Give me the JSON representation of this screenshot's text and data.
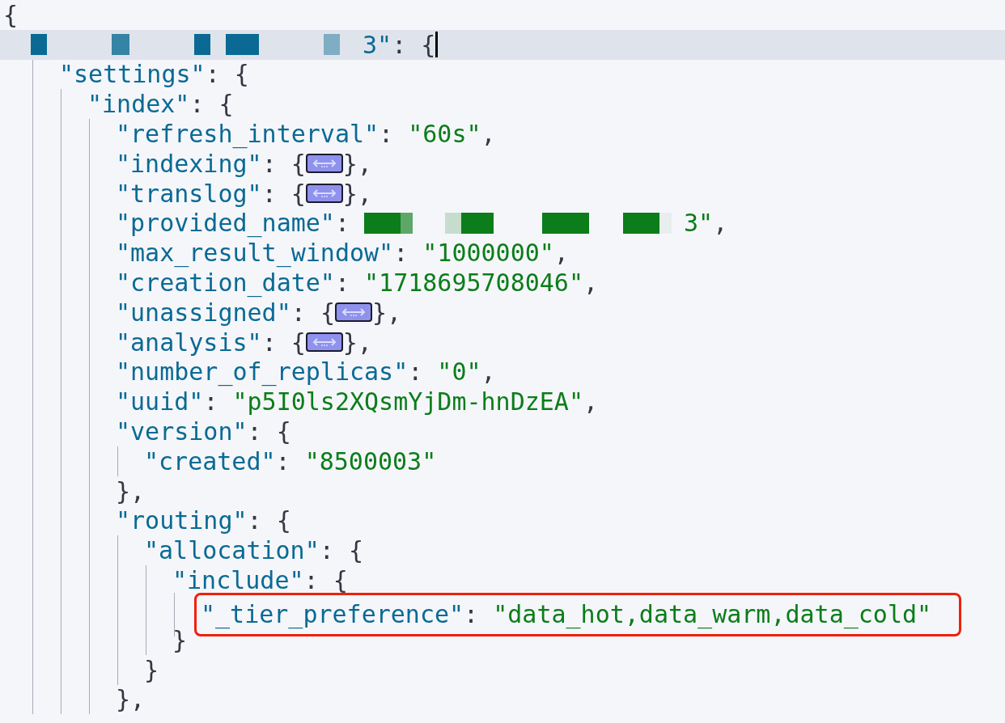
{
  "document": {
    "open": "{",
    "children": [
      {
        "redacted": true,
        "key_tail": "3\"",
        "sep": ": ",
        "open": "{",
        "current": true,
        "children": [
          {
            "key": "\"settings\"",
            "sep": ": ",
            "open": "{",
            "children": [
              {
                "key": "\"index\"",
                "sep": ": ",
                "open": "{",
                "children": [
                  {
                    "key": "\"refresh_interval\"",
                    "sep": ": ",
                    "value": "\"60s\"",
                    "end": ","
                  },
                  {
                    "key": "\"indexing\"",
                    "sep": ": ",
                    "open": "{",
                    "collapsed": true,
                    "close": "},"
                  },
                  {
                    "key": "\"translog\"",
                    "sep": ": ",
                    "open": "{",
                    "collapsed": true,
                    "close": "},"
                  },
                  {
                    "key": "\"provided_name\"",
                    "sep": ": ",
                    "value_redacted": true,
                    "value_tail": "3\"",
                    "end": ","
                  },
                  {
                    "key": "\"max_result_window\"",
                    "sep": ": ",
                    "value": "\"1000000\"",
                    "end": ","
                  },
                  {
                    "key": "\"creation_date\"",
                    "sep": ": ",
                    "value": "\"1718695708046\"",
                    "end": ","
                  },
                  {
                    "key": "\"unassigned\"",
                    "sep": ": ",
                    "open": "{",
                    "collapsed": true,
                    "close": "},"
                  },
                  {
                    "key": "\"analysis\"",
                    "sep": ": ",
                    "open": "{",
                    "collapsed": true,
                    "close": "},"
                  },
                  {
                    "key": "\"number_of_replicas\"",
                    "sep": ": ",
                    "value": "\"0\"",
                    "end": ","
                  },
                  {
                    "key": "\"uuid\"",
                    "sep": ": ",
                    "value": "\"p5I0ls2XQsmYjDm-hnDzEA\"",
                    "end": ","
                  },
                  {
                    "key": "\"version\"",
                    "sep": ": ",
                    "open": "{",
                    "close": "},",
                    "children": [
                      {
                        "key": "\"created\"",
                        "sep": ": ",
                        "value": "\"8500003\""
                      }
                    ]
                  },
                  {
                    "key": "\"routing\"",
                    "sep": ": ",
                    "open": "{",
                    "close": "},",
                    "children": [
                      {
                        "key": "\"allocation\"",
                        "sep": ": ",
                        "open": "{",
                        "close": "}",
                        "children": [
                          {
                            "key": "\"include\"",
                            "sep": ": ",
                            "open": "{",
                            "close": "}",
                            "children": [
                              {
                                "key": "\"_tier_preference\"",
                                "sep": ": ",
                                "value": "\"data_hot,data_warm,data_cold\"",
                                "highlighted": true
                              }
                            ]
                          }
                        ]
                      }
                    ]
                  }
                ]
              }
            ]
          }
        ]
      }
    ]
  }
}
